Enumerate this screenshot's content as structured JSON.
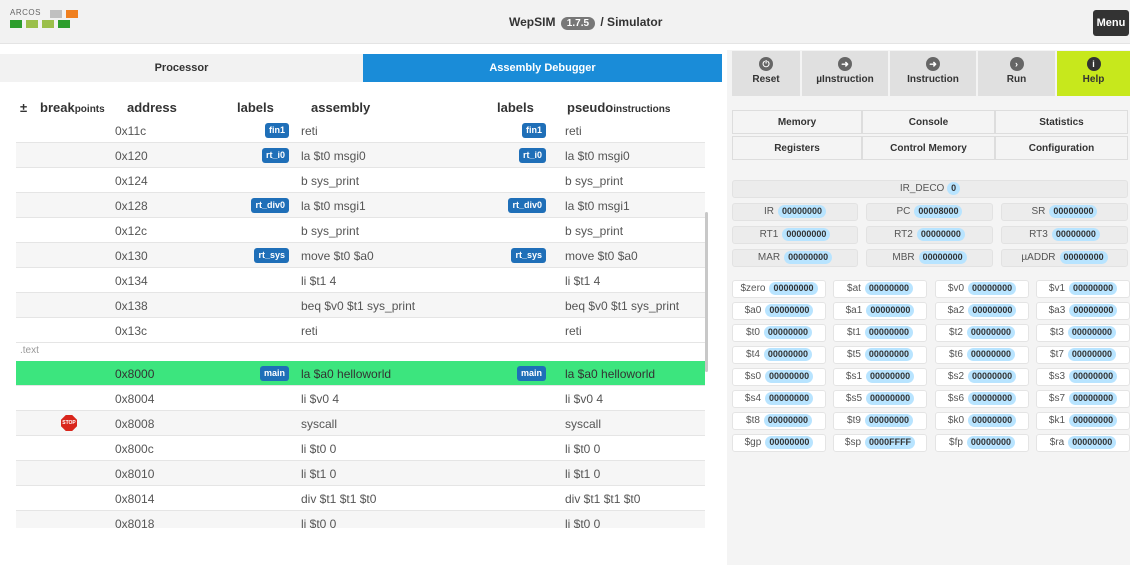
{
  "app": {
    "logo_text": "ARCOS",
    "title_prefix": "WepSIM",
    "version": "1.7.5",
    "title_suffix": "/ Simulator",
    "menu_label": "Menu"
  },
  "left_tabs": [
    "Processor",
    "Assembly Debugger"
  ],
  "table_headers": {
    "toggle": "±",
    "breakpoints_main": "break",
    "breakpoints_small": "points",
    "address": "address",
    "labels": "labels",
    "assembly": "assembly",
    "labels2": "labels",
    "pseudo_main": "pseudo",
    "pseudo_small": "instructions"
  },
  "rows": [
    {
      "addr": "0x11c",
      "label": "fin1",
      "asm": "reti",
      "label2": "fin1",
      "pseudo": "reti"
    },
    {
      "addr": "0x120",
      "label": "rt_i0",
      "asm": "la $t0 msgi0",
      "label2": "rt_i0",
      "pseudo": "la $t0 msgi0"
    },
    {
      "addr": "0x124",
      "label": "",
      "asm": "b sys_print",
      "label2": "",
      "pseudo": "b sys_print"
    },
    {
      "addr": "0x128",
      "label": "rt_div0",
      "asm": "la $t0 msgi1",
      "label2": "rt_div0",
      "pseudo": "la $t0 msgi1"
    },
    {
      "addr": "0x12c",
      "label": "",
      "asm": "b sys_print",
      "label2": "",
      "pseudo": "b sys_print"
    },
    {
      "addr": "0x130",
      "label": "rt_sys",
      "asm": "move $t0 $a0",
      "label2": "rt_sys",
      "pseudo": "move $t0 $a0"
    },
    {
      "addr": "0x134",
      "label": "",
      "asm": "li $t1 4",
      "label2": "",
      "pseudo": "li $t1 4"
    },
    {
      "addr": "0x138",
      "label": "",
      "asm": "beq $v0 $t1 sys_print",
      "label2": "",
      "pseudo": "beq $v0 $t1 sys_print"
    },
    {
      "addr": "0x13c",
      "label": "",
      "asm": "reti",
      "label2": "",
      "pseudo": "reti"
    },
    {
      "addr": "0x8000",
      "label": "main",
      "asm": "la $a0 helloworld",
      "label2": "main",
      "pseudo": "la $a0 helloworld"
    },
    {
      "addr": "0x8004",
      "label": "",
      "asm": "li $v0 4",
      "label2": "",
      "pseudo": "li $v0 4"
    },
    {
      "addr": "0x8008",
      "label": "",
      "asm": "syscall",
      "label2": "",
      "pseudo": "syscall"
    },
    {
      "addr": "0x800c",
      "label": "",
      "asm": "li $t0 0",
      "label2": "",
      "pseudo": "li $t0 0"
    },
    {
      "addr": "0x8010",
      "label": "",
      "asm": "li $t1 0",
      "label2": "",
      "pseudo": "li $t1 0"
    },
    {
      "addr": "0x8014",
      "label": "",
      "asm": "div $t1 $t1 $t0",
      "label2": "",
      "pseudo": "div $t1 $t1 $t0"
    },
    {
      "addr": "0x8018",
      "label": "",
      "asm": "li $t0 0",
      "label2": "",
      "pseudo": "li $t0 0"
    }
  ],
  "section_label": ".text",
  "breakpoint_text": "STOP",
  "actions": [
    {
      "label": "Reset",
      "icon": "power-icon"
    },
    {
      "label": "µInstruction",
      "icon": "arrow-right-icon"
    },
    {
      "label": "Instruction",
      "icon": "arrow-right-icon"
    },
    {
      "label": "Run",
      "icon": "play-icon"
    },
    {
      "label": "Help",
      "icon": "info-icon"
    }
  ],
  "panel_tabs": [
    "Memory",
    "Console",
    "Statistics",
    "Registers",
    "Control Memory",
    "Configuration"
  ],
  "special_regs": {
    "ir_deco": {
      "name": "IR_DECO",
      "value": "0"
    },
    "grid": [
      {
        "name": "IR",
        "value": "00000000"
      },
      {
        "name": "PC",
        "value": "00008000"
      },
      {
        "name": "SR",
        "value": "00000000"
      },
      {
        "name": "RT1",
        "value": "00000000"
      },
      {
        "name": "RT2",
        "value": "00000000"
      },
      {
        "name": "RT3",
        "value": "00000000"
      },
      {
        "name": "MAR",
        "value": "00000000"
      },
      {
        "name": "MBR",
        "value": "00000000"
      },
      {
        "name": "µADDR",
        "value": "00000000"
      }
    ]
  },
  "gp_regs": [
    {
      "name": "$zero",
      "value": "00000000"
    },
    {
      "name": "$at",
      "value": "00000000"
    },
    {
      "name": "$v0",
      "value": "00000000"
    },
    {
      "name": "$v1",
      "value": "00000000"
    },
    {
      "name": "$a0",
      "value": "00000000"
    },
    {
      "name": "$a1",
      "value": "00000000"
    },
    {
      "name": "$a2",
      "value": "00000000"
    },
    {
      "name": "$a3",
      "value": "00000000"
    },
    {
      "name": "$t0",
      "value": "00000000"
    },
    {
      "name": "$t1",
      "value": "00000000"
    },
    {
      "name": "$t2",
      "value": "00000000"
    },
    {
      "name": "$t3",
      "value": "00000000"
    },
    {
      "name": "$t4",
      "value": "00000000"
    },
    {
      "name": "$t5",
      "value": "00000000"
    },
    {
      "name": "$t6",
      "value": "00000000"
    },
    {
      "name": "$t7",
      "value": "00000000"
    },
    {
      "name": "$s0",
      "value": "00000000"
    },
    {
      "name": "$s1",
      "value": "00000000"
    },
    {
      "name": "$s2",
      "value": "00000000"
    },
    {
      "name": "$s3",
      "value": "00000000"
    },
    {
      "name": "$s4",
      "value": "00000000"
    },
    {
      "name": "$s5",
      "value": "00000000"
    },
    {
      "name": "$s6",
      "value": "00000000"
    },
    {
      "name": "$s7",
      "value": "00000000"
    },
    {
      "name": "$t8",
      "value": "00000000"
    },
    {
      "name": "$t9",
      "value": "00000000"
    },
    {
      "name": "$k0",
      "value": "00000000"
    },
    {
      "name": "$k1",
      "value": "00000000"
    },
    {
      "name": "$gp",
      "value": "00000000"
    },
    {
      "name": "$sp",
      "value": "0000FFFF"
    },
    {
      "name": "$fp",
      "value": "00000000"
    },
    {
      "name": "$ra",
      "value": "00000000"
    }
  ],
  "colors": {
    "accent": "#1a8cd8",
    "highlight_row": "#3ce57e",
    "help_button": "#c7e81c",
    "label_badge": "#1f6fb8",
    "register_value": "#b8e4ff"
  }
}
